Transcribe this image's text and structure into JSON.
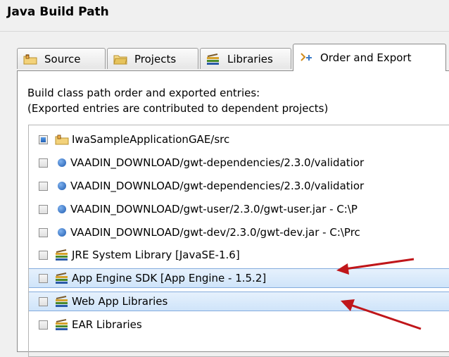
{
  "page_title": "Java Build Path",
  "tabs": [
    {
      "label": "Source",
      "icon": "source-folder-icon",
      "active": false
    },
    {
      "label": "Projects",
      "icon": "projects-folder-icon",
      "active": false
    },
    {
      "label": "Libraries",
      "icon": "libraries-icon",
      "active": false
    },
    {
      "label": "Order and Export",
      "icon": "order-export-icon",
      "active": true
    }
  ],
  "description": {
    "line1": "Build class path order and exported entries:",
    "line2": "(Exported entries are contributed to dependent projects)"
  },
  "entries": [
    {
      "label": "IwaSampleApplicationGAE/src",
      "icon": "source-folder-icon",
      "checked": true,
      "selected": false
    },
    {
      "label": "VAADIN_DOWNLOAD/gwt-dependencies/2.3.0/validatior",
      "icon": "variable-jar-icon",
      "checked": false,
      "selected": false
    },
    {
      "label": "VAADIN_DOWNLOAD/gwt-dependencies/2.3.0/validatior",
      "icon": "variable-jar-icon",
      "checked": false,
      "selected": false
    },
    {
      "label": "VAADIN_DOWNLOAD/gwt-user/2.3.0/gwt-user.jar - C:\\P",
      "icon": "variable-jar-icon",
      "checked": false,
      "selected": false
    },
    {
      "label": "VAADIN_DOWNLOAD/gwt-dev/2.3.0/gwt-dev.jar - C:\\Prc",
      "icon": "variable-jar-icon",
      "checked": false,
      "selected": false
    },
    {
      "label": "JRE System Library [JavaSE-1.6]",
      "icon": "library-icon",
      "checked": false,
      "selected": false
    },
    {
      "label": "App Engine SDK [App Engine - 1.5.2]",
      "icon": "library-icon",
      "checked": false,
      "selected": true
    },
    {
      "label": "Web App Libraries",
      "icon": "library-icon",
      "checked": false,
      "selected": true
    },
    {
      "label": "EAR Libraries",
      "icon": "library-icon",
      "checked": false,
      "selected": false
    }
  ],
  "colors": {
    "arrow": "#c0161a",
    "selection": "#cfe4fa",
    "checkbox_checked": "#1f5fb5"
  }
}
